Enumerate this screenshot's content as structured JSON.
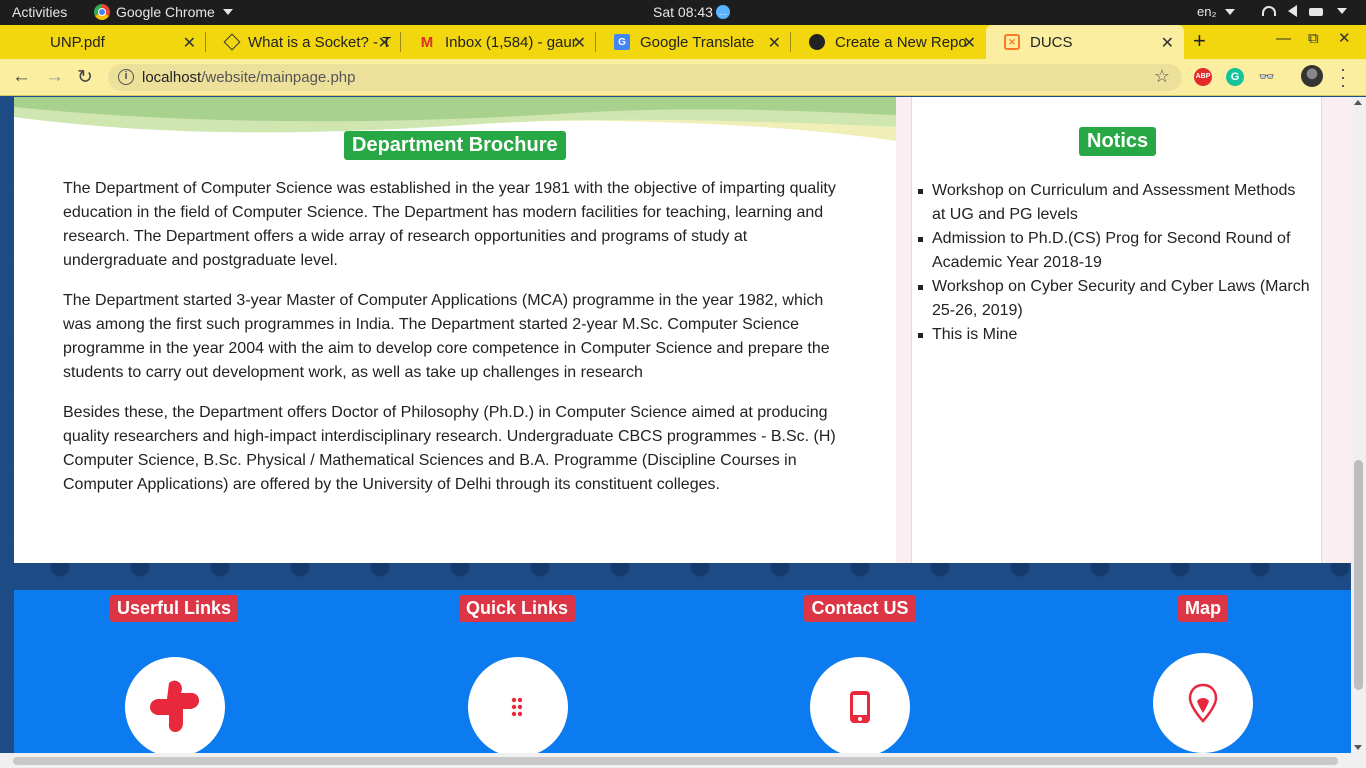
{
  "system_bar": {
    "activities": "Activities",
    "app_name": "Google Chrome",
    "clock": "Sat 08:43",
    "lang": "en₂"
  },
  "tabs": [
    {
      "title": "UNP.pdf",
      "icon": "pdf-icon"
    },
    {
      "title": "What is a Socket? - T",
      "icon": "socket-site-icon"
    },
    {
      "title": "Inbox (1,584) - gaur",
      "icon": "gmail-icon"
    },
    {
      "title": "Google Translate",
      "icon": "google-translate-icon"
    },
    {
      "title": "Create a New Repo",
      "icon": "github-icon"
    },
    {
      "title": "DUCS",
      "icon": "xampp-icon",
      "active": true
    }
  ],
  "toolbar": {
    "url_host": "localhost",
    "url_path": "/website/mainpage.php",
    "extensions": [
      "ABP",
      "G"
    ]
  },
  "brochure": {
    "title": "Department Brochure",
    "paragraphs": [
      "The Department of Computer Science was established in the year 1981 with the objective of imparting quality education in the field of Computer Science. The Department has modern facilities for teaching, learning and research. The Department offers a wide array of research opportunities and programs of study at undergraduate and postgraduate level.",
      "The Department started 3-year Master of Computer Applications (MCA) programme in the year 1982, which was among the first such programmes in India. The Department started 2-year M.Sc. Computer Science programme in the year 2004 with the aim to develop core competence in Computer Science and prepare the students to carry out development work, as well as take up challenges in research",
      "Besides these, the Department offers Doctor of Philosophy (Ph.D.) in Computer Science aimed at producing quality researchers and high-impact interdisciplinary research. Undergraduate CBCS programmes - B.Sc. (H) Computer Science, B.Sc. Physical / Mathematical Sciences and B.A. Programme (Discipline Courses in Computer Applications) are offered by the University of Delhi through its constituent colleges."
    ]
  },
  "notices": {
    "title": "Notics",
    "items": [
      "Workshop on Curriculum and Assessment Methods at UG and PG levels",
      "Admission to Ph.D.(CS) Prog for Second Round of Academic Year 2018-19",
      "Workshop on Cyber Security and Cyber Laws (March 25-26, 2019)",
      "This is Mine"
    ]
  },
  "footer": {
    "columns": [
      {
        "label": "Userful Links",
        "icon": "puzzle-plus-icon"
      },
      {
        "label": "Quick Links",
        "icon": "dots-icon"
      },
      {
        "label": "Contact US",
        "icon": "mobile-phone-icon"
      },
      {
        "label": "Map",
        "icon": "map-pin-icon"
      }
    ]
  },
  "colors": {
    "tab_strip": "#f2d60e",
    "toolbar": "#fbeea0",
    "heading_green": "#28a745",
    "footer_blue": "#0b7bef",
    "footer_label_red": "#dc3545"
  }
}
